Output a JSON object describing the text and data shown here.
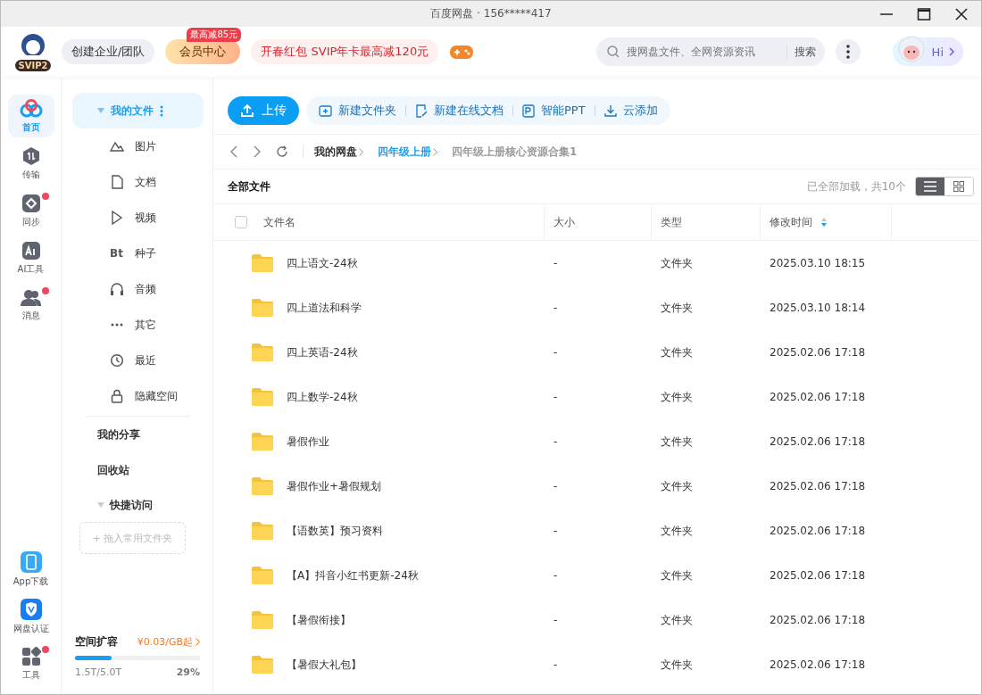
{
  "window": {
    "title": "百度网盘 · 156*****417"
  },
  "header": {
    "vip_badge": "SVIP2",
    "team_button": "创建企业/团队",
    "member_button": "会员中心",
    "member_tag": "最高减85元",
    "promo": "开春红包 SVIP年卡最高减120元",
    "search": {
      "placeholder": "搜网盘文件、全网资源资讯",
      "button": "搜索"
    },
    "hi_button": "Hi"
  },
  "rail": [
    {
      "label": "首页",
      "kind": "home",
      "selected": true,
      "badge": false
    },
    {
      "label": "传输",
      "kind": "transfer",
      "selected": false,
      "badge": false
    },
    {
      "label": "同步",
      "kind": "sync",
      "selected": false,
      "badge": true
    },
    {
      "label": "AI工具",
      "kind": "ai",
      "selected": false,
      "badge": false
    },
    {
      "label": "消息",
      "kind": "message",
      "selected": false,
      "badge": true
    }
  ],
  "rail_bottom": [
    {
      "label": "App下载",
      "kind": "phone",
      "badge": false
    },
    {
      "label": "网盘认证",
      "kind": "shield",
      "badge": false
    },
    {
      "label": "工具",
      "kind": "tools",
      "badge": true
    }
  ],
  "nav": {
    "my_files": {
      "label": "我的文件",
      "expanded": true,
      "selected": true
    },
    "categories": [
      {
        "label": "图片",
        "kind": "image"
      },
      {
        "label": "文档",
        "kind": "doc"
      },
      {
        "label": "视频",
        "kind": "video"
      },
      {
        "label": "种子",
        "kind": "bt",
        "glyph": "Bt"
      },
      {
        "label": "音频",
        "kind": "audio"
      },
      {
        "label": "其它",
        "kind": "more"
      },
      {
        "label": "最近",
        "kind": "clock"
      },
      {
        "label": "隐藏空间",
        "kind": "lock"
      }
    ],
    "links": [
      "我的分享",
      "回收站"
    ],
    "quick_access": {
      "label": "快捷访问",
      "expanded": true,
      "drop_hint": "+ 拖入常用文件夹"
    }
  },
  "storage": {
    "title": "空间扩容",
    "offer": "¥0.03/GB起",
    "usage": "1.5T/5.0T",
    "percent": "29%",
    "level": 0.29
  },
  "toolbar": {
    "upload": "上传",
    "actions": [
      {
        "label": "新建文件夹",
        "kind": "folder-plus"
      },
      {
        "label": "新建在线文档",
        "kind": "doc-edit"
      },
      {
        "label": "智能PPT",
        "kind": "ppt"
      },
      {
        "label": "云添加",
        "kind": "download"
      }
    ]
  },
  "breadcrumb": [
    {
      "label": "我的网盘",
      "kind": "root"
    },
    {
      "label": "四年级上册",
      "kind": "link"
    },
    {
      "label": "四年级上册核心资源合集1",
      "kind": "current"
    }
  ],
  "list": {
    "title": "全部文件",
    "status": "已全部加载，共10个",
    "views": [
      {
        "kind": "list",
        "selected": true
      },
      {
        "kind": "grid",
        "selected": false
      }
    ]
  },
  "table": {
    "all_checked": false,
    "columns": [
      {
        "label": "文件名",
        "sorted": false
      },
      {
        "label": "大小",
        "sorted": false
      },
      {
        "label": "类型",
        "sorted": false
      },
      {
        "label": "修改时间",
        "sorted": true
      }
    ],
    "rows": [
      {
        "name": "四上语文-24秋",
        "size": "-",
        "type": "文件夹",
        "modified": "2025.03.10 18:15"
      },
      {
        "name": "四上道法和科学",
        "size": "-",
        "type": "文件夹",
        "modified": "2025.03.10 18:14"
      },
      {
        "name": "四上英语-24秋",
        "size": "-",
        "type": "文件夹",
        "modified": "2025.02.06 17:18"
      },
      {
        "name": "四上数学-24秋",
        "size": "-",
        "type": "文件夹",
        "modified": "2025.02.06 17:18"
      },
      {
        "name": "暑假作业",
        "size": "-",
        "type": "文件夹",
        "modified": "2025.02.06 17:18"
      },
      {
        "name": "暑假作业+暑假规划",
        "size": "-",
        "type": "文件夹",
        "modified": "2025.02.06 17:18"
      },
      {
        "name": "【语数英】预习资料",
        "size": "-",
        "type": "文件夹",
        "modified": "2025.02.06 17:18"
      },
      {
        "name": "【A】抖音小红书更新-24秋",
        "size": "-",
        "type": "文件夹",
        "modified": "2025.02.06 17:18"
      },
      {
        "name": "【暑假衔接】",
        "size": "-",
        "type": "文件夹",
        "modified": "2025.02.06 17:18"
      },
      {
        "name": "【暑假大礼包】",
        "size": "-",
        "type": "文件夹",
        "modified": "2025.02.06 17:18"
      }
    ]
  }
}
